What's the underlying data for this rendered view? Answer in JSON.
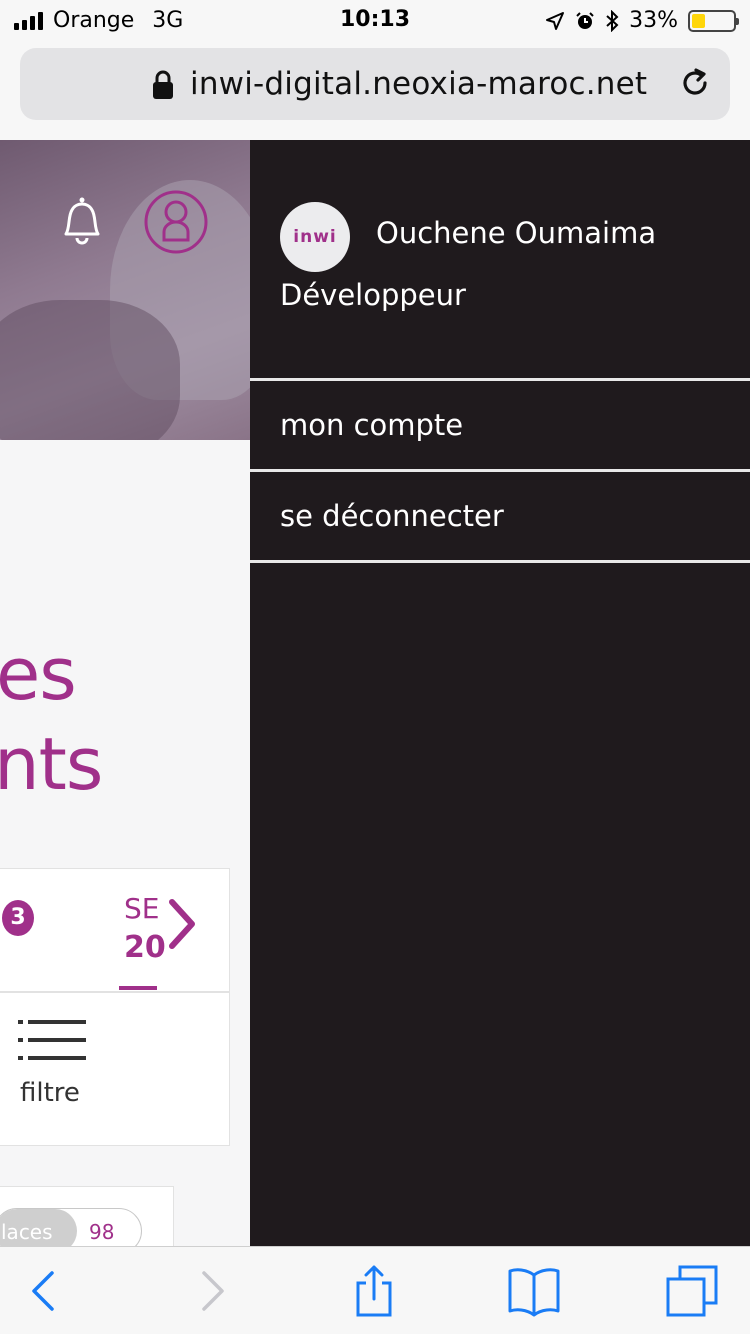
{
  "status_bar": {
    "carrier": "Orange",
    "network": "3G",
    "time": "10:13",
    "battery_percent": "33%",
    "battery_level": 0.33
  },
  "browser": {
    "url": "inwi-digital.neoxia-maroc.net"
  },
  "page": {
    "heading_line1": "es",
    "heading_line2": "nts",
    "badge_count": "3",
    "month_label_top": "SE",
    "month_label_bottom": "20",
    "filter_label": "filtre",
    "places_label": "laces",
    "places_count": "98",
    "accent_color": "#a0308a"
  },
  "drawer": {
    "logo_text": "inwi",
    "user_name": "Ouchene Oumaima",
    "user_role": "Développeur",
    "menu": [
      {
        "label": "mon compte"
      },
      {
        "label": "se déconnecter"
      }
    ],
    "background_color": "#1f1a1d"
  },
  "toolbar": {
    "icons": [
      "back-icon",
      "forward-icon",
      "share-icon",
      "bookmarks-icon",
      "tabs-icon"
    ]
  }
}
